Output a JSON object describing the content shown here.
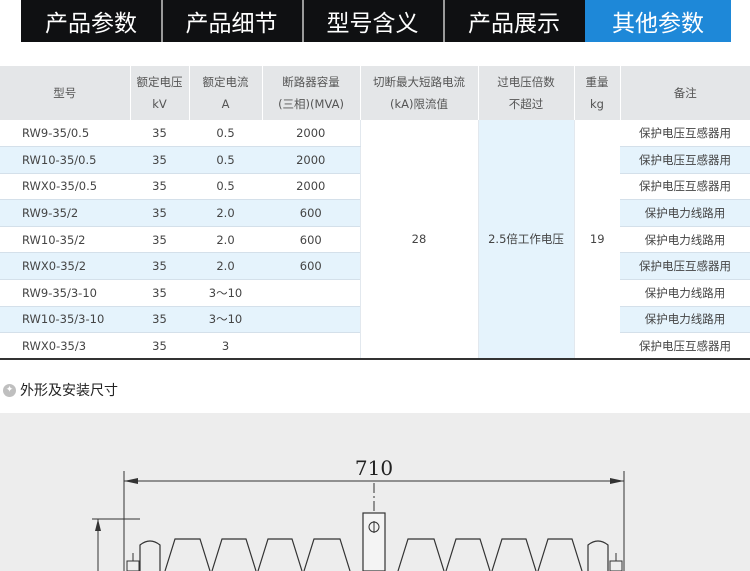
{
  "tabs": [
    {
      "label": "产品参数"
    },
    {
      "label": "产品细节"
    },
    {
      "label": "型号含义"
    },
    {
      "label": "产品展示"
    },
    {
      "label": "其他参数"
    }
  ],
  "colors": {
    "active_tab": "#1e88d8",
    "tab_bar": "#0f1012",
    "row_alt": "#e5f3fc",
    "header_bg": "#e4e6e8"
  },
  "table": {
    "headers": {
      "model": [
        "型号"
      ],
      "voltage": [
        "额定电压",
        "kV"
      ],
      "current": [
        "额定电流",
        "A"
      ],
      "capacity": [
        "断路器容量",
        "(三相)(MVA)"
      ],
      "short_circuit": [
        "切断最大短路电流",
        "(kA)限流值"
      ],
      "overvoltage": [
        "过电压倍数",
        "不超过"
      ],
      "weight": [
        "重量",
        "kg"
      ],
      "note": [
        "备注"
      ]
    },
    "rows": [
      {
        "model": "RW9-35/0.5",
        "voltage": "35",
        "current": "0.5",
        "capacity": "2000",
        "note": "保护电压互感器用"
      },
      {
        "model": "RW10-35/0.5",
        "voltage": "35",
        "current": "0.5",
        "capacity": "2000",
        "note": "保护电压互感器用"
      },
      {
        "model": "RWX0-35/0.5",
        "voltage": "35",
        "current": "0.5",
        "capacity": "2000",
        "note": "保护电压互感器用"
      },
      {
        "model": "RW9-35/2",
        "voltage": "35",
        "current": "2.0",
        "capacity": "600",
        "note": "保护电力线路用"
      },
      {
        "model": "RW10-35/2",
        "voltage": "35",
        "current": "2.0",
        "capacity": "600",
        "note": "保护电力线路用"
      },
      {
        "model": "RWX0-35/2",
        "voltage": "35",
        "current": "2.0",
        "capacity": "600",
        "note": "保护电压互感器用"
      },
      {
        "model": "RW9-35/3-10",
        "voltage": "35",
        "current": "3～10",
        "capacity": "",
        "note": "保护电力线路用"
      },
      {
        "model": "RW10-35/3-10",
        "voltage": "35",
        "current": "3～10",
        "capacity": "",
        "note": "保护电力线路用"
      },
      {
        "model": "RWX0-35/3",
        "voltage": "35",
        "current": "3",
        "capacity": "",
        "note": "保护电压互感器用"
      }
    ],
    "merged": {
      "short_circuit": "28",
      "overvoltage": "2.5倍工作电压",
      "weight": "19"
    }
  },
  "section": {
    "icon": "wrench-icon",
    "title": "外形及安装尺寸"
  },
  "drawing": {
    "dimension": "710"
  }
}
